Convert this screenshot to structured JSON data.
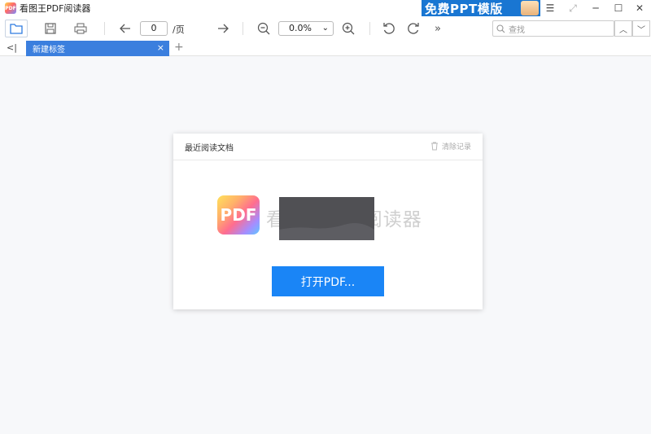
{
  "window": {
    "logo_text": "PDF",
    "title": "看图王PDF阅读器",
    "ad_banner": "免费PPT模版",
    "controls": {
      "menu": "☰",
      "restore": "⤢",
      "minimize": "─",
      "maximize": "☐",
      "close": "✕"
    }
  },
  "toolbar": {
    "page_value": "0",
    "page_suffix": "/页",
    "zoom_value": "0.0%",
    "more": "»",
    "search_placeholder": "查找"
  },
  "tabs": {
    "active_label": "新建标签",
    "close": "×",
    "add": "+",
    "collapse": "<|"
  },
  "card": {
    "header_title": "最近阅读文档",
    "clear_label": "清除记录",
    "brand_logo_text": "PDF",
    "brand_text": "看图王PDF阅读器",
    "open_button": "打开PDF..."
  },
  "colors": {
    "accent": "#1a85f6",
    "tab_active": "#3b7fde",
    "ad_banner": "#1976d2"
  }
}
